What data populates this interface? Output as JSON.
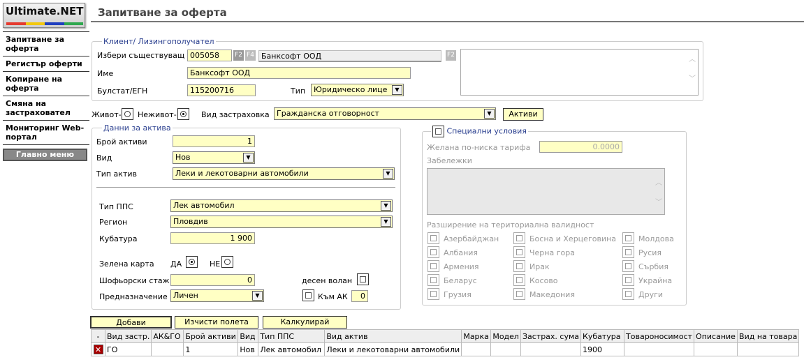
{
  "app": {
    "logo": "Ultimate.NET",
    "logo_colors": [
      "#e53b2f",
      "#f2c80f",
      "#1f3fbf",
      "#2fa84f"
    ]
  },
  "nav": {
    "items": [
      "Запитване за оферта",
      "Регистър оферти",
      "Копиране на оферта",
      "Смяна на застраховател",
      "Мониторинг Web-портал"
    ],
    "main_menu": "Главно меню"
  },
  "page_title": "Запитване за оферта",
  "client": {
    "legend": "Клиент/ Лизингополучател",
    "select_label": "Избери съществуващ",
    "code": "005058",
    "f2": "F2",
    "f4": "F4",
    "client_name_display": "Банксофт ООД",
    "f2b": "F2",
    "name_label": "Име",
    "name": "Банксофт ООД",
    "egn_label": "Булстат/ЕГН",
    "egn": "115200716",
    "type_label": "Тип",
    "type": "Юридическо лице"
  },
  "insurance": {
    "alive_label": "Живот-",
    "nonlife_label": "Неживот-",
    "type_label": "Вид застраховка",
    "type": "Гражданска отговорност",
    "assets_button": "Активи"
  },
  "asset": {
    "legend": "Данни за актива",
    "count_label": "Брой активи",
    "count": "1",
    "kind_label": "Вид",
    "kind": "Нов",
    "asset_type_label": "Тип актив",
    "asset_type": "Леки и лекотоварни автомобили",
    "pps_label": "Тип ППС",
    "pps": "Лек автомобил",
    "region_label": "Регион",
    "region": "Пловдив",
    "cc_label": "Кубатура",
    "cc": "1 900",
    "green_card_label": "Зелена карта",
    "yes": "ДА",
    "no": "НЕ",
    "experience_label": "Шофьорски стаж",
    "experience": "0",
    "rhd_label": "десен волан",
    "purpose_label": "Предназначение",
    "purpose": "Личен",
    "to_ak_label": "Към АК",
    "to_ak": "0"
  },
  "special": {
    "legend": "Специални условия",
    "tariff_label": "Желана по-ниска тарифа",
    "tariff": "0.0000",
    "notes_label": "Забележки",
    "ext_label": "Разширение на териториална валидност",
    "countries": [
      [
        "Азербайджан",
        "Босна и Херцеговина",
        "Молдова"
      ],
      [
        "Албания",
        "Черна гора",
        "Русия"
      ],
      [
        "Армения",
        "Ирак",
        "Сърбия"
      ],
      [
        "Беларус",
        "Косово",
        "Украйна"
      ],
      [
        "Грузия",
        "Македония",
        "Други"
      ]
    ]
  },
  "actions": {
    "add": "Добави",
    "clear": "Изчисти полета",
    "calc": "Калкулирай"
  },
  "table": {
    "headers": [
      "-",
      "Вид застр.",
      "АК&ГО",
      "Брой активи",
      "Вид",
      "Тип ППС",
      "Вид актив",
      "Марка",
      "Модел",
      "Застрах. сума",
      "Кубатура",
      "Товароносимост",
      "Описание",
      "Вид на товара"
    ],
    "rows": [
      [
        "",
        "ГО",
        "",
        "1",
        "Нов",
        "Лек автомобил",
        "Леки и лекотоварни автомобили",
        "",
        "",
        "",
        "1900",
        "",
        "",
        ""
      ]
    ]
  }
}
